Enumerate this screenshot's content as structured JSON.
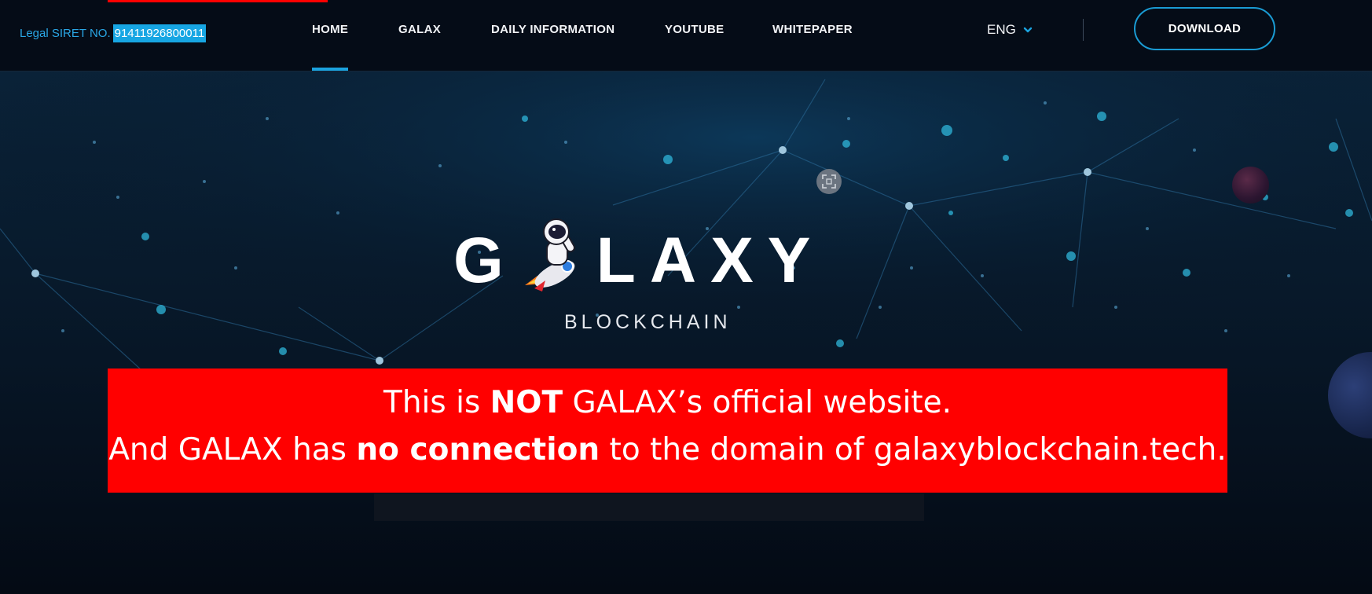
{
  "header": {
    "siret_label": "Legal SIRET NO.",
    "siret_number": "91411926800011",
    "nav": [
      {
        "label": "HOME",
        "active": true
      },
      {
        "label": "GALAX"
      },
      {
        "label": "DAILY INFORMATION"
      },
      {
        "label": "YOUTUBE"
      },
      {
        "label": "WHITEPAPER"
      }
    ],
    "language": "ENG",
    "download_label": "DOWNLOAD"
  },
  "hero": {
    "logo_left": "G",
    "logo_right": "LAXY",
    "logo_sub": "BLOCKCHAIN"
  },
  "warning": {
    "line1_pre": "This is ",
    "line1_bold": "NOT",
    "line1_post": " GALAX’s official website.",
    "line2_pre": "And GALAX has ",
    "line2_bold": "no connection",
    "line2_post": " to the domain of galaxyblockchain.tech."
  },
  "colors": {
    "accent": "#1ba3df",
    "warning_bg": "#ff0000",
    "background": "#050d18"
  }
}
